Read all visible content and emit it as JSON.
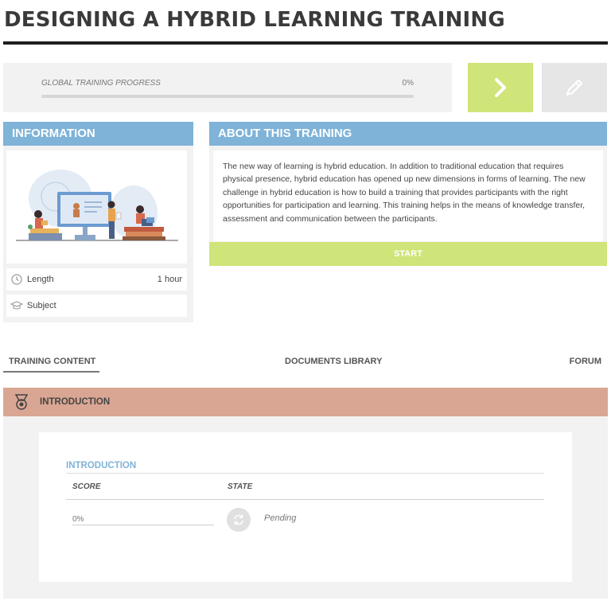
{
  "page": {
    "title": "DESIGNING A HYBRID LEARNING TRAINING"
  },
  "progress": {
    "label": "GLOBAL TRAINING PROGRESS",
    "value": "0%",
    "fraction": 0
  },
  "actions": {
    "next_icon": "chevron-right-icon",
    "edit_icon": "pencil-icon"
  },
  "information": {
    "header": "INFORMATION",
    "illustration": "hybrid-learning-illustration",
    "rows": [
      {
        "icon": "clock-icon",
        "label": "Length",
        "value": "1 hour"
      },
      {
        "icon": "graduation-cap-icon",
        "label": "Subject",
        "value": ""
      }
    ]
  },
  "about": {
    "header": "ABOUT THIS TRAINING",
    "text": "The new way of learning is hybrid education. In addition to traditional education that requires physical presence, hybrid education has opened up new dimensions in forms of learning. The new challenge in hybrid education is how to build a training that provides participants with the right opportunities for participation and learning. This training helps in the means of knowledge transfer, assessment and communication between the participants.",
    "start_label": "START"
  },
  "tabs": [
    {
      "label": "TRAINING CONTENT",
      "active": true
    },
    {
      "label": "DOCUMENTS LIBRARY",
      "active": false
    },
    {
      "label": "FORUM",
      "active": false
    }
  ],
  "module": {
    "icon": "medal-icon",
    "title": "INTRODUCTION",
    "item": {
      "title": "INTRODUCTION",
      "columns": {
        "score": "SCORE",
        "state": "STATE"
      },
      "score": "0%",
      "state_icon": "refresh-icon",
      "state": "Pending"
    }
  },
  "colors": {
    "accent_green": "#cfe479",
    "header_blue": "#7fb3d8",
    "module_salmon": "#d9a693"
  }
}
